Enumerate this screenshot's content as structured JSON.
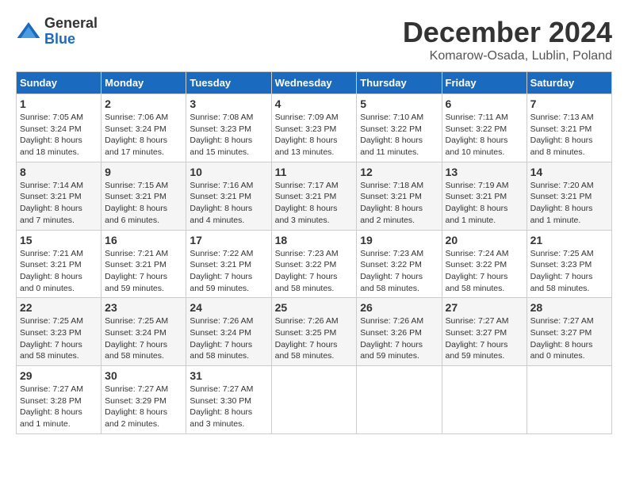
{
  "header": {
    "logo_general": "General",
    "logo_blue": "Blue",
    "month_title": "December 2024",
    "location": "Komarow-Osada, Lublin, Poland"
  },
  "calendar": {
    "days_of_week": [
      "Sunday",
      "Monday",
      "Tuesday",
      "Wednesday",
      "Thursday",
      "Friday",
      "Saturday"
    ],
    "weeks": [
      [
        null,
        {
          "day": "2",
          "sunrise": "Sunrise: 7:06 AM",
          "sunset": "Sunset: 3:24 PM",
          "daylight": "Daylight: 8 hours and 17 minutes."
        },
        {
          "day": "3",
          "sunrise": "Sunrise: 7:08 AM",
          "sunset": "Sunset: 3:23 PM",
          "daylight": "Daylight: 8 hours and 15 minutes."
        },
        {
          "day": "4",
          "sunrise": "Sunrise: 7:09 AM",
          "sunset": "Sunset: 3:23 PM",
          "daylight": "Daylight: 8 hours and 13 minutes."
        },
        {
          "day": "5",
          "sunrise": "Sunrise: 7:10 AM",
          "sunset": "Sunset: 3:22 PM",
          "daylight": "Daylight: 8 hours and 11 minutes."
        },
        {
          "day": "6",
          "sunrise": "Sunrise: 7:11 AM",
          "sunset": "Sunset: 3:22 PM",
          "daylight": "Daylight: 8 hours and 10 minutes."
        },
        {
          "day": "7",
          "sunrise": "Sunrise: 7:13 AM",
          "sunset": "Sunset: 3:21 PM",
          "daylight": "Daylight: 8 hours and 8 minutes."
        }
      ],
      [
        {
          "day": "8",
          "sunrise": "Sunrise: 7:14 AM",
          "sunset": "Sunset: 3:21 PM",
          "daylight": "Daylight: 8 hours and 7 minutes."
        },
        {
          "day": "9",
          "sunrise": "Sunrise: 7:15 AM",
          "sunset": "Sunset: 3:21 PM",
          "daylight": "Daylight: 8 hours and 6 minutes."
        },
        {
          "day": "10",
          "sunrise": "Sunrise: 7:16 AM",
          "sunset": "Sunset: 3:21 PM",
          "daylight": "Daylight: 8 hours and 4 minutes."
        },
        {
          "day": "11",
          "sunrise": "Sunrise: 7:17 AM",
          "sunset": "Sunset: 3:21 PM",
          "daylight": "Daylight: 8 hours and 3 minutes."
        },
        {
          "day": "12",
          "sunrise": "Sunrise: 7:18 AM",
          "sunset": "Sunset: 3:21 PM",
          "daylight": "Daylight: 8 hours and 2 minutes."
        },
        {
          "day": "13",
          "sunrise": "Sunrise: 7:19 AM",
          "sunset": "Sunset: 3:21 PM",
          "daylight": "Daylight: 8 hours and 1 minute."
        },
        {
          "day": "14",
          "sunrise": "Sunrise: 7:20 AM",
          "sunset": "Sunset: 3:21 PM",
          "daylight": "Daylight: 8 hours and 1 minute."
        }
      ],
      [
        {
          "day": "15",
          "sunrise": "Sunrise: 7:21 AM",
          "sunset": "Sunset: 3:21 PM",
          "daylight": "Daylight: 8 hours and 0 minutes."
        },
        {
          "day": "16",
          "sunrise": "Sunrise: 7:21 AM",
          "sunset": "Sunset: 3:21 PM",
          "daylight": "Daylight: 7 hours and 59 minutes."
        },
        {
          "day": "17",
          "sunrise": "Sunrise: 7:22 AM",
          "sunset": "Sunset: 3:21 PM",
          "daylight": "Daylight: 7 hours and 59 minutes."
        },
        {
          "day": "18",
          "sunrise": "Sunrise: 7:23 AM",
          "sunset": "Sunset: 3:22 PM",
          "daylight": "Daylight: 7 hours and 58 minutes."
        },
        {
          "day": "19",
          "sunrise": "Sunrise: 7:23 AM",
          "sunset": "Sunset: 3:22 PM",
          "daylight": "Daylight: 7 hours and 58 minutes."
        },
        {
          "day": "20",
          "sunrise": "Sunrise: 7:24 AM",
          "sunset": "Sunset: 3:22 PM",
          "daylight": "Daylight: 7 hours and 58 minutes."
        },
        {
          "day": "21",
          "sunrise": "Sunrise: 7:25 AM",
          "sunset": "Sunset: 3:23 PM",
          "daylight": "Daylight: 7 hours and 58 minutes."
        }
      ],
      [
        {
          "day": "22",
          "sunrise": "Sunrise: 7:25 AM",
          "sunset": "Sunset: 3:23 PM",
          "daylight": "Daylight: 7 hours and 58 minutes."
        },
        {
          "day": "23",
          "sunrise": "Sunrise: 7:25 AM",
          "sunset": "Sunset: 3:24 PM",
          "daylight": "Daylight: 7 hours and 58 minutes."
        },
        {
          "day": "24",
          "sunrise": "Sunrise: 7:26 AM",
          "sunset": "Sunset: 3:24 PM",
          "daylight": "Daylight: 7 hours and 58 minutes."
        },
        {
          "day": "25",
          "sunrise": "Sunrise: 7:26 AM",
          "sunset": "Sunset: 3:25 PM",
          "daylight": "Daylight: 7 hours and 58 minutes."
        },
        {
          "day": "26",
          "sunrise": "Sunrise: 7:26 AM",
          "sunset": "Sunset: 3:26 PM",
          "daylight": "Daylight: 7 hours and 59 minutes."
        },
        {
          "day": "27",
          "sunrise": "Sunrise: 7:27 AM",
          "sunset": "Sunset: 3:27 PM",
          "daylight": "Daylight: 7 hours and 59 minutes."
        },
        {
          "day": "28",
          "sunrise": "Sunrise: 7:27 AM",
          "sunset": "Sunset: 3:27 PM",
          "daylight": "Daylight: 8 hours and 0 minutes."
        }
      ],
      [
        {
          "day": "29",
          "sunrise": "Sunrise: 7:27 AM",
          "sunset": "Sunset: 3:28 PM",
          "daylight": "Daylight: 8 hours and 1 minute."
        },
        {
          "day": "30",
          "sunrise": "Sunrise: 7:27 AM",
          "sunset": "Sunset: 3:29 PM",
          "daylight": "Daylight: 8 hours and 2 minutes."
        },
        {
          "day": "31",
          "sunrise": "Sunrise: 7:27 AM",
          "sunset": "Sunset: 3:30 PM",
          "daylight": "Daylight: 8 hours and 3 minutes."
        },
        null,
        null,
        null,
        null
      ]
    ],
    "first_week": [
      {
        "day": "1",
        "sunrise": "Sunrise: 7:05 AM",
        "sunset": "Sunset: 3:24 PM",
        "daylight": "Daylight: 8 hours and 18 minutes."
      }
    ]
  }
}
